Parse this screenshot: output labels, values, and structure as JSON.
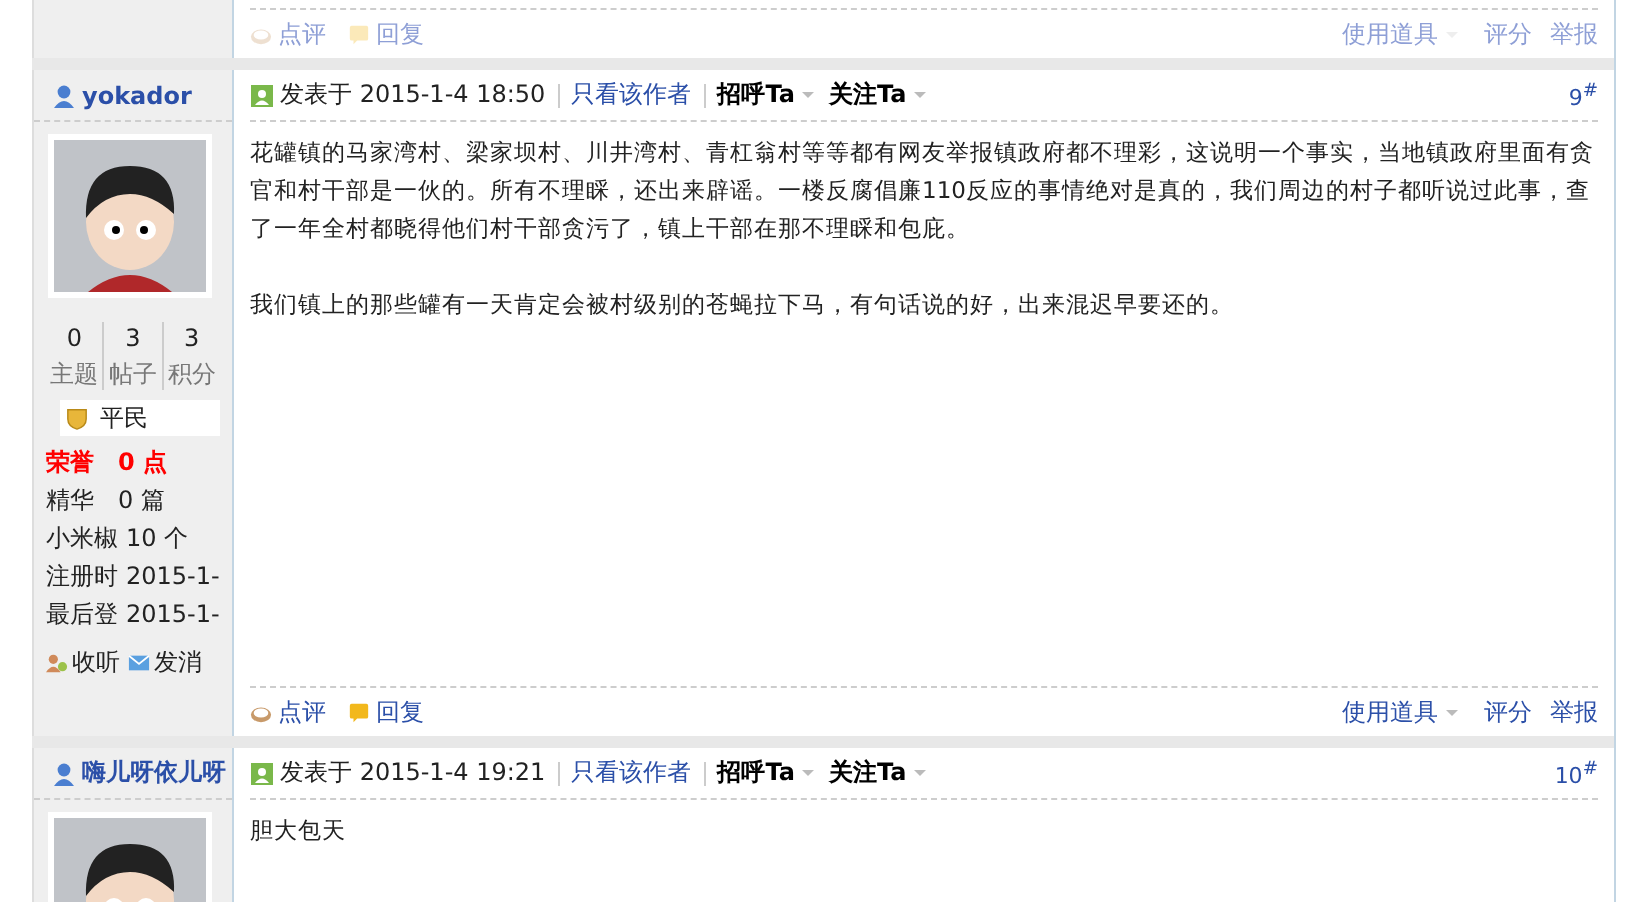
{
  "posts": [
    {
      "faded": true,
      "footer": {
        "actions": [
          "点评",
          "回复"
        ],
        "tools": [
          "使用道具",
          "评分",
          "举报"
        ]
      }
    },
    {
      "faded": false,
      "author": {
        "name": "yokador",
        "stats": [
          {
            "value": "0",
            "label": "主题"
          },
          {
            "value": "3",
            "label": "帖子"
          },
          {
            "value": "3",
            "label": "积分"
          }
        ],
        "rank": "平民",
        "fields": [
          {
            "label": "荣誉",
            "value": "0 点",
            "highlight": true
          },
          {
            "label": "精华",
            "value": "0 篇",
            "highlight": false
          },
          {
            "label": "小米椒",
            "value": "10 个",
            "highlight": false
          },
          {
            "label": "注册时",
            "value": "2015-1-",
            "highlight": false
          },
          {
            "label": "最后登",
            "value": "2015-1-",
            "highlight": false
          }
        ],
        "links": [
          "收听",
          "发消"
        ]
      },
      "header": {
        "posted": "发表于 2015-1-4 18:50",
        "only_author": "只看该作者",
        "greet": "招呼Ta",
        "follow": "关注Ta",
        "floor": "9$^{#}$"
      },
      "body": [
        "花罐镇的马家湾村、梁家坝村、川井湾村、青杠翁村等等都有网友举报镇政府都不理彩，这说明一个事实，当地镇政府里面有贪官和村干部是一伙的。所有不理睬，还出来辟谣。一楼反腐倡廉110反应的事情绝对是真的，我们周边的村子都听说过此事，查了一年全村都晓得他们村干部贪污了，镇上干部在那不理睬和包庇。",
        "我们镇上的那些罐有一天肯定会被村级别的苍蝇拉下马，有句话说的好，出来混迟早要还的。"
      ],
      "footer": {
        "actions": [
          "点评",
          "回复"
        ],
        "tools": [
          "使用道具",
          "评分",
          "举报"
        ]
      }
    },
    {
      "author": {
        "name": "嗨儿呀依儿呀"
      },
      "header": {
        "posted": "发表于 2015-1-4 19:21",
        "only_author": "只看该作者",
        "greet": "招呼Ta",
        "follow": "关注Ta",
        "floor": "10$^{#}$"
      },
      "body": [
        "胆大包天"
      ]
    }
  ]
}
